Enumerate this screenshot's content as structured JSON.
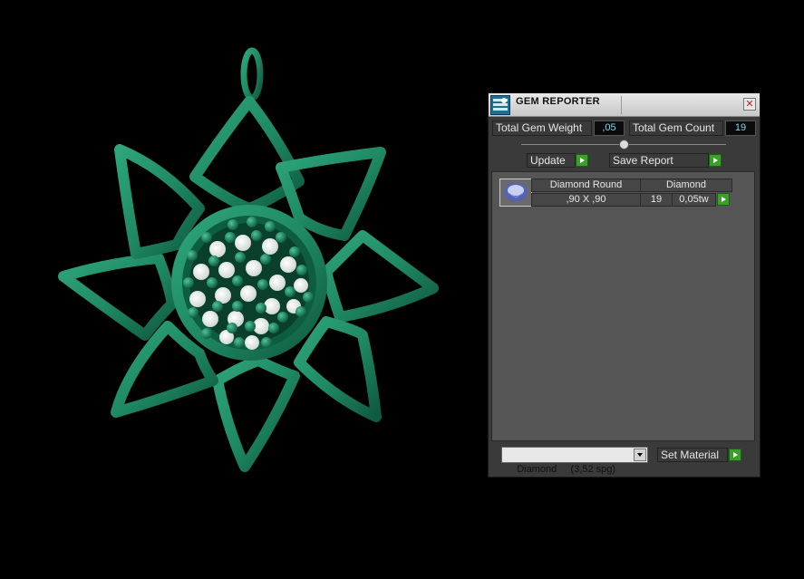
{
  "panel": {
    "title": "GEM REPORTER",
    "total_gem_weight_label": "Total Gem Weight",
    "total_gem_weight_value": ",05",
    "total_gem_count_label": "Total Gem Count",
    "total_gem_count_value": "19",
    "update_label": "Update",
    "save_report_label": "Save Report",
    "gem_entry": {
      "shape": "Diamond Round",
      "material": "Diamond",
      "size": ",90 X ,90",
      "count": "19",
      "weight": "0,05tw"
    },
    "material_select_value": "Diamond     (3,52 spg)",
    "set_material_label": "Set Material"
  },
  "colors": {
    "pendant_green": "#1f8a64",
    "panel_bg": "#3a3a3a",
    "list_bg": "#555555",
    "value_text": "#7fd7e8",
    "action_green": "#3aa02a"
  },
  "icons": [
    "gem-reporter-app-icon",
    "close-icon",
    "play-arrow-icon",
    "dropdown-arrow-icon",
    "gem-thumbnail-icon"
  ]
}
